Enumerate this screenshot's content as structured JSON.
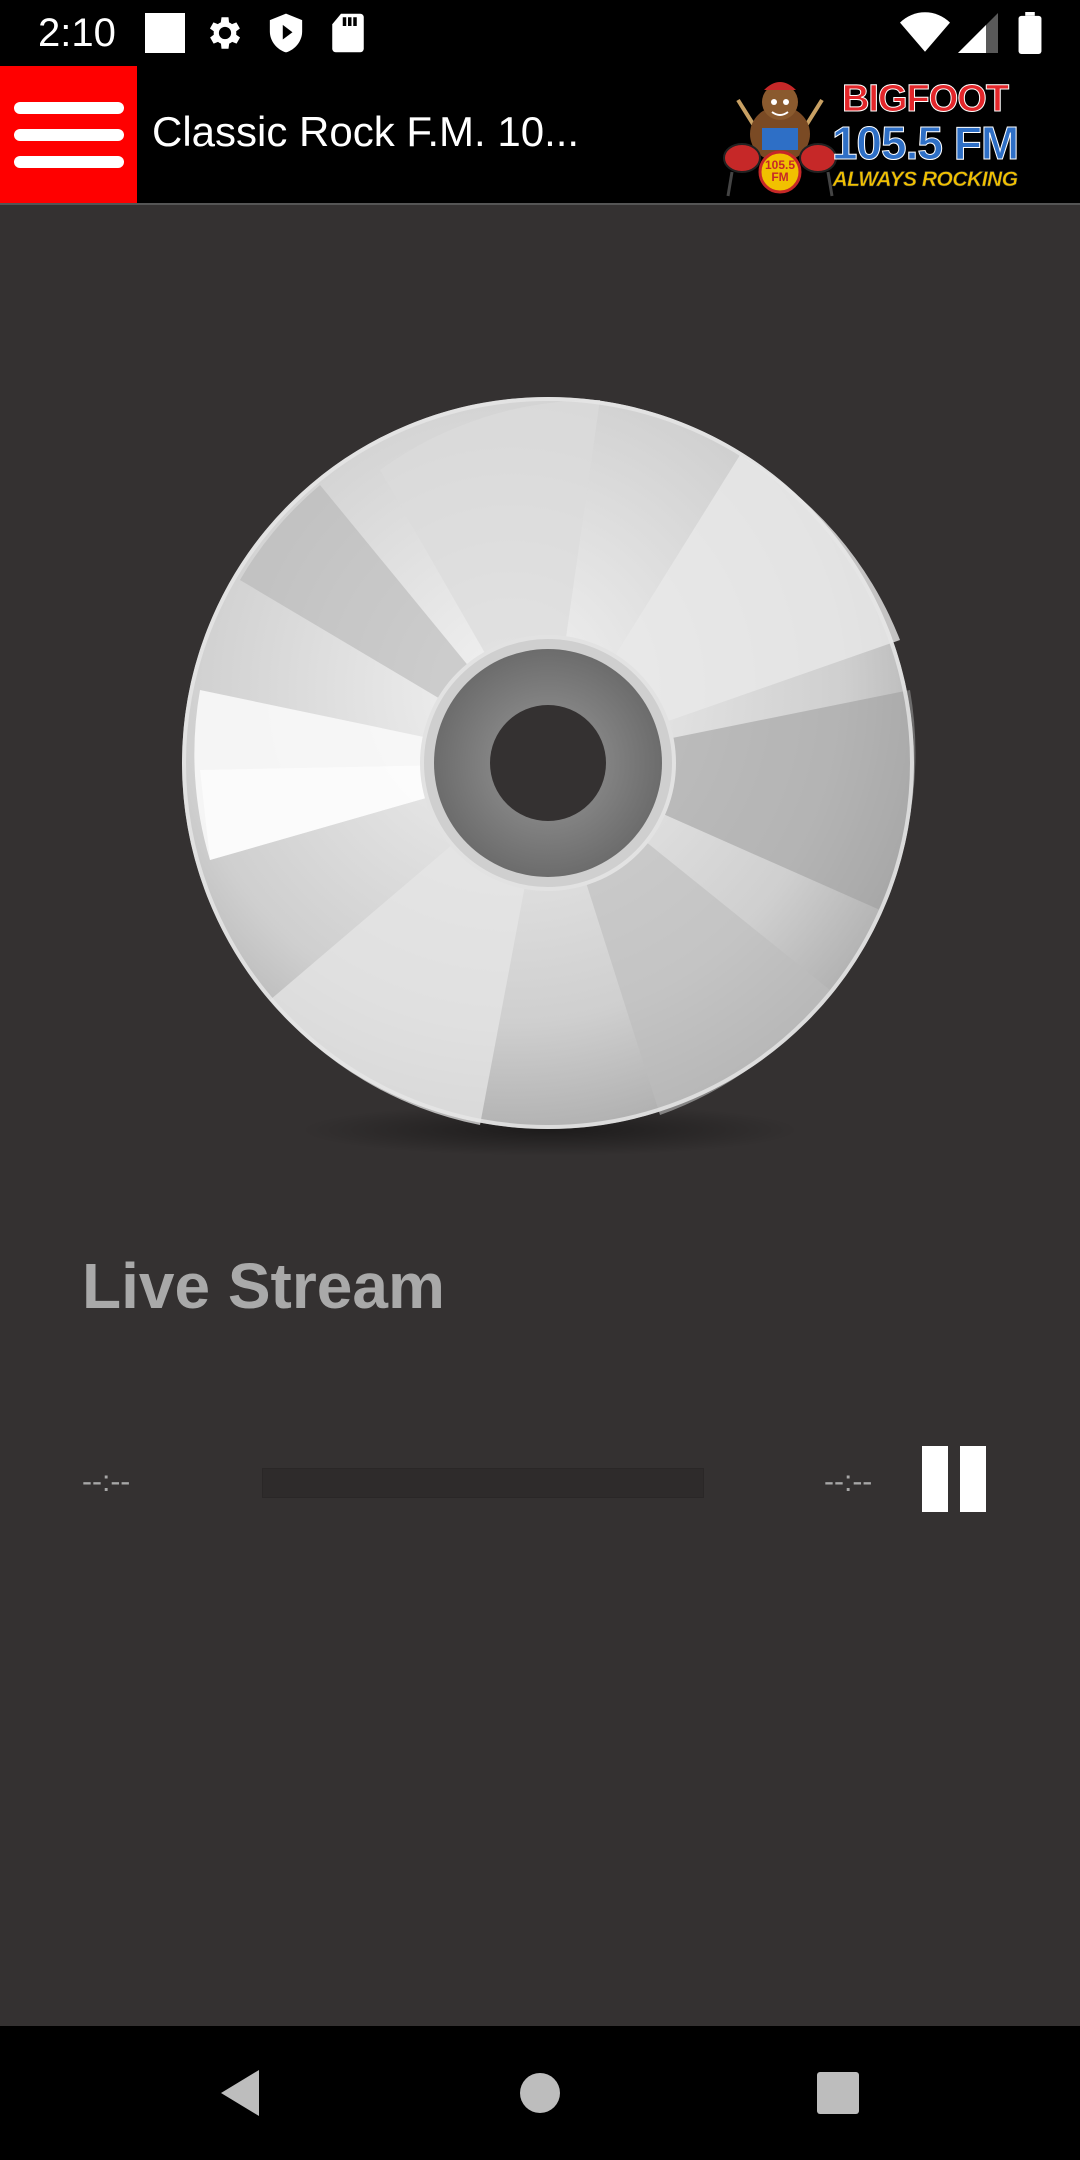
{
  "status_bar": {
    "time": "2:10",
    "left_icons": [
      "square-notification-icon",
      "gear-icon",
      "shield-icon",
      "sd-card-icon"
    ],
    "right_icons": [
      "wifi-icon",
      "cell-signal-icon",
      "battery-icon"
    ]
  },
  "app_bar": {
    "title": "Classic Rock F.M. 10...",
    "menu_icon": "hamburger-menu-icon",
    "menu_color": "#ff0000",
    "logo": {
      "line1": "BIGFOOT",
      "line2": "105.5 FM",
      "line3": "ALWAYS ROCKING",
      "badge": "105.5 FM"
    }
  },
  "player": {
    "disc_icon": "cd-disc-icon",
    "track_title": "Live Stream",
    "time_elapsed": "--:--",
    "time_total": "--:--",
    "progress": 0,
    "pause_icon": "pause-icon"
  },
  "nav_bar": {
    "buttons": [
      "back-icon",
      "home-icon",
      "recents-icon"
    ]
  },
  "colors": {
    "background": "#343131",
    "app_bar": "#000000",
    "menu_accent": "#ff0000",
    "title_text": "#a9a9a9"
  }
}
